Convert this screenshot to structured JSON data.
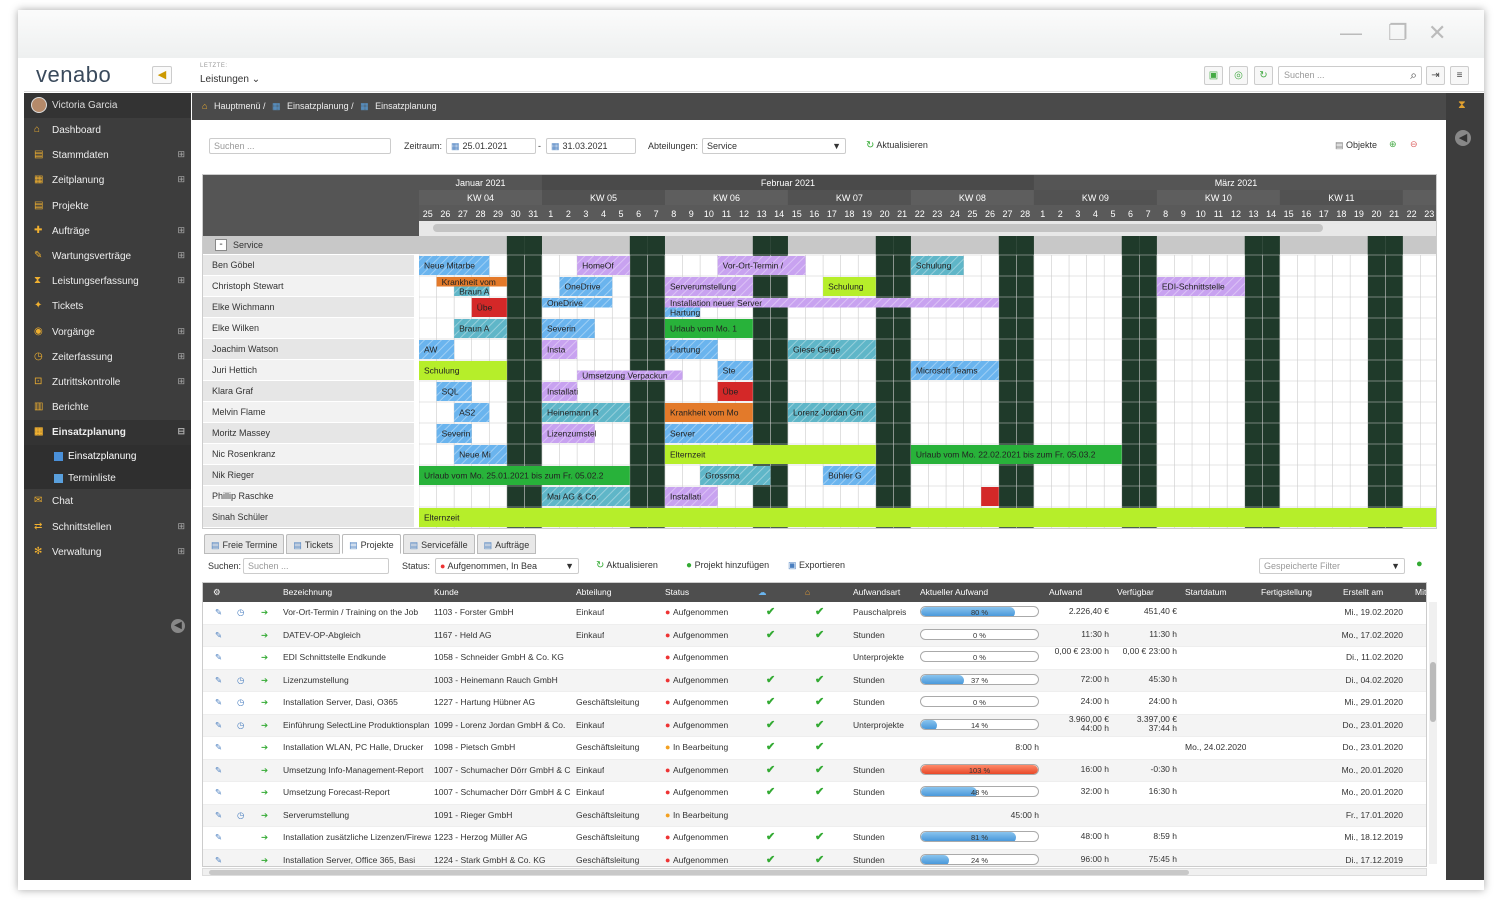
{
  "window": {
    "min": "—",
    "max": "❐",
    "close": "✕"
  },
  "app": {
    "logo": "venabo",
    "letzte": "LETZTE:",
    "recent": "Leistungen ⌄",
    "search_placeholder": "Suchen ..."
  },
  "user": {
    "name": "Victoria Garcia"
  },
  "sidebar": [
    {
      "label": "Dashboard",
      "icon": "home-icon",
      "plus": ""
    },
    {
      "label": "Stammdaten",
      "icon": "folder-icon",
      "plus": "⊞"
    },
    {
      "label": "Zeitplanung",
      "icon": "calendar-icon",
      "plus": "⊞"
    },
    {
      "label": "Projekte",
      "icon": "folder-icon",
      "plus": ""
    },
    {
      "label": "Aufträge",
      "icon": "order-icon",
      "plus": "⊞"
    },
    {
      "label": "Wartungsverträge",
      "icon": "wrench-icon",
      "plus": "⊞"
    },
    {
      "label": "Leistungserfassung",
      "icon": "hourglass-icon",
      "plus": "⊞"
    },
    {
      "label": "Tickets",
      "icon": "ticket-icon",
      "plus": ""
    },
    {
      "label": "Vorgänge",
      "icon": "process-icon",
      "plus": "⊞"
    },
    {
      "label": "Zeiterfassung",
      "icon": "clock-icon",
      "plus": "⊞"
    },
    {
      "label": "Zutrittskontrolle",
      "icon": "door-icon",
      "plus": "⊞"
    },
    {
      "label": "Berichte",
      "icon": "report-icon",
      "plus": ""
    },
    {
      "label": "Einsatzplanung",
      "icon": "plan-icon",
      "plus": "⊟"
    }
  ],
  "sidebar_sub": [
    "Einsatzplanung",
    "Terminliste"
  ],
  "sidebar_bottom": [
    {
      "label": "Chat",
      "icon": "chat-icon",
      "plus": ""
    },
    {
      "label": "Schnittstellen",
      "icon": "plug-icon",
      "plus": "⊞"
    },
    {
      "label": "Verwaltung",
      "icon": "gear-icon",
      "plus": "⊞"
    }
  ],
  "breadcrumb": [
    "Hauptmenü /",
    "Einsatzplanung /",
    "Einsatzplanung"
  ],
  "filters": {
    "search_placeholder": "Suchen ...",
    "zeitraum_label": "Zeitraum:",
    "date_from": "25.01.2021",
    "date_sep": "-",
    "date_to": "31.03.2021",
    "abteilungen_label": "Abteilungen:",
    "abteilung": "Service",
    "refresh": "Aktualisieren",
    "objekte": "Objekte"
  },
  "gantt": {
    "months": [
      {
        "label": "Januar 2021",
        "days": 7
      },
      {
        "label": "Februar 2021",
        "days": 28
      },
      {
        "label": "März 2021",
        "days": 23
      }
    ],
    "weeks": [
      {
        "label": "KW 04",
        "days": 7
      },
      {
        "label": "KW 05",
        "days": 7
      },
      {
        "label": "KW 06",
        "days": 7
      },
      {
        "label": "KW 07",
        "days": 7
      },
      {
        "label": "KW 08",
        "days": 7
      },
      {
        "label": "KW 09",
        "days": 7
      },
      {
        "label": "KW 10",
        "days": 7
      },
      {
        "label": "KW 11",
        "days": 7
      },
      {
        "label": "",
        "days": 2
      }
    ],
    "days": [
      "25",
      "26",
      "27",
      "28",
      "29",
      "30",
      "31",
      "1",
      "2",
      "3",
      "4",
      "5",
      "6",
      "7",
      "8",
      "9",
      "10",
      "11",
      "12",
      "13",
      "14",
      "15",
      "16",
      "17",
      "18",
      "19",
      "20",
      "21",
      "22",
      "23",
      "24",
      "25",
      "26",
      "27",
      "28",
      "1",
      "2",
      "3",
      "4",
      "5",
      "6",
      "7",
      "8",
      "9",
      "10",
      "11",
      "12",
      "13",
      "14",
      "15",
      "16",
      "17",
      "18",
      "19",
      "20",
      "21",
      "22",
      "23"
    ],
    "group": "Service",
    "employees": [
      "Ben Göbel",
      "Christoph Stewart",
      "Elke Wichmann",
      "Elke Wilken",
      "Joachim Watson",
      "Juri Hettich",
      "Klara Graf",
      "Melvin Flame",
      "Moritz Massey",
      "Nic Rosenkranz",
      "Nik Rieger",
      "Phillip Raschke",
      "Sinah Schüler"
    ],
    "colors": {
      "blue": "#6ab4ee",
      "purple": "#c8a2f0",
      "green": "#28b23a",
      "lime": "#b6ee2a",
      "orange": "#e37a2a",
      "red": "#d42828",
      "teal": "#5fb6c8",
      "weekend": "#1f3a2a"
    },
    "events": [
      {
        "row": 0,
        "start": 0,
        "len": 4,
        "color": "blue",
        "label": "Neue Mitarbe"
      },
      {
        "row": 0,
        "start": 9,
        "len": 3,
        "color": "purple",
        "label": "HomeOf"
      },
      {
        "row": 0,
        "start": 17,
        "len": 5,
        "color": "purple",
        "label": "Vor-Ort-Termin /"
      },
      {
        "row": 0,
        "start": 28,
        "len": 3,
        "color": "teal",
        "label": "Schulung"
      },
      {
        "row": 1,
        "start": 1,
        "len": 4,
        "color": "orange",
        "label": "Krankheit vom",
        "half": "top"
      },
      {
        "row": 1,
        "start": 2,
        "len": 2,
        "color": "teal",
        "label": "Braun A",
        "half": "bottom"
      },
      {
        "row": 1,
        "start": 8,
        "len": 3,
        "color": "blue",
        "label": "OneDrive"
      },
      {
        "row": 1,
        "start": 14,
        "len": 5,
        "color": "purple",
        "label": "Serverumstellung"
      },
      {
        "row": 1,
        "start": 23,
        "len": 3,
        "color": "lime",
        "label": "Schulung"
      },
      {
        "row": 1,
        "start": 42,
        "len": 5,
        "color": "purple",
        "label": "EDI-Schnittstelle"
      },
      {
        "row": 2,
        "start": 3,
        "len": 2,
        "color": "red",
        "label": "Übe"
      },
      {
        "row": 2,
        "start": 7,
        "len": 4,
        "color": "blue",
        "label": "OneDrive",
        "half": "top"
      },
      {
        "row": 2,
        "start": 14,
        "len": 19,
        "color": "purple",
        "label": "Installation neuer Server",
        "half": "top"
      },
      {
        "row": 2,
        "start": 14,
        "len": 2,
        "color": "blue",
        "label": "Hartung",
        "half": "bottom"
      },
      {
        "row": 3,
        "start": 2,
        "len": 3,
        "color": "teal",
        "label": "Braun A"
      },
      {
        "row": 3,
        "start": 7,
        "len": 3,
        "color": "blue",
        "label": "Severin"
      },
      {
        "row": 3,
        "start": 14,
        "len": 5,
        "color": "green",
        "label": "Urlaub vom Mo. 1"
      },
      {
        "row": 4,
        "start": 0,
        "len": 2,
        "color": "blue",
        "label": "AW"
      },
      {
        "row": 4,
        "start": 7,
        "len": 2,
        "color": "purple",
        "label": "Insta"
      },
      {
        "row": 4,
        "start": 14,
        "len": 3,
        "color": "blue",
        "label": "Hartung"
      },
      {
        "row": 4,
        "start": 21,
        "len": 5,
        "color": "teal",
        "label": "Giese Geige"
      },
      {
        "row": 5,
        "start": 0,
        "len": 5,
        "color": "lime",
        "label": "Schulung"
      },
      {
        "row": 5,
        "start": 9,
        "len": 6,
        "color": "purple",
        "label": "Umsetzung Verpackun",
        "half": "bottom"
      },
      {
        "row": 5,
        "start": 17,
        "len": 2,
        "color": "blue",
        "label": "Ste"
      },
      {
        "row": 5,
        "start": 28,
        "len": 5,
        "color": "blue",
        "label": "Microsoft Teams"
      },
      {
        "row": 6,
        "start": 1,
        "len": 2,
        "color": "blue",
        "label": "SQL"
      },
      {
        "row": 6,
        "start": 7,
        "len": 2,
        "color": "purple",
        "label": "Installati"
      },
      {
        "row": 6,
        "start": 17,
        "len": 2,
        "color": "red",
        "label": "Übe"
      },
      {
        "row": 7,
        "start": 2,
        "len": 2,
        "color": "blue",
        "label": "AS2"
      },
      {
        "row": 7,
        "start": 7,
        "len": 5,
        "color": "teal",
        "label": "Heinemann R"
      },
      {
        "row": 7,
        "start": 14,
        "len": 5,
        "color": "orange",
        "label": "Krankheit vom Mo"
      },
      {
        "row": 7,
        "start": 21,
        "len": 5,
        "color": "teal",
        "label": "Lorenz Jordan Gm"
      },
      {
        "row": 8,
        "start": 1,
        "len": 2,
        "color": "blue",
        "label": "Severin"
      },
      {
        "row": 8,
        "start": 7,
        "len": 3,
        "color": "purple",
        "label": "Lizenzumstel"
      },
      {
        "row": 8,
        "start": 14,
        "len": 5,
        "color": "blue",
        "label": "Server"
      },
      {
        "row": 9,
        "start": 2,
        "len": 3,
        "color": "blue",
        "label": "Neue Mi"
      },
      {
        "row": 9,
        "start": 14,
        "len": 12,
        "color": "lime",
        "label": "Elternzeit"
      },
      {
        "row": 9,
        "start": 28,
        "len": 12,
        "color": "green",
        "label": "Urlaub vom Mo. 22.02.2021 bis zum Fr. 05.03.2"
      },
      {
        "row": 10,
        "start": 0,
        "len": 12,
        "color": "green",
        "label": "Urlaub vom Mo. 25.01.2021 bis zum Fr. 05.02.2"
      },
      {
        "row": 10,
        "start": 16,
        "len": 4,
        "color": "teal",
        "label": "Grossma"
      },
      {
        "row": 10,
        "start": 23,
        "len": 3,
        "color": "blue",
        "label": "Bühler G"
      },
      {
        "row": 11,
        "start": 7,
        "len": 5,
        "color": "teal",
        "label": "Mai AG & Co."
      },
      {
        "row": 11,
        "start": 14,
        "len": 3,
        "color": "purple",
        "label": "Installati"
      },
      {
        "row": 11,
        "start": 32,
        "len": 1,
        "color": "red",
        "label": ""
      },
      {
        "row": 12,
        "start": 0,
        "len": 58,
        "color": "lime",
        "label": "Elternzeit"
      }
    ]
  },
  "tabs": [
    "Freie Termine",
    "Tickets",
    "Projekte",
    "Servicefälle",
    "Aufträge"
  ],
  "proj": {
    "search_label": "Suchen:",
    "search_placeholder": "Suchen ...",
    "status_label": "Status:",
    "status_value": "Aufgenommen, In Bea",
    "refresh": "Aktualisieren",
    "add": "Projekt hinzufügen",
    "export": "Exportieren",
    "filter_placeholder": "Gespeicherte Filter",
    "columns": [
      "Bezeichnung",
      "Kunde",
      "Abteilung",
      "Status",
      "",
      "",
      "Aufwandsart",
      "Aktueller Aufwand",
      "Aufwand",
      "Verfügbar",
      "Startdatum",
      "Fertigstellung",
      "Erstellt am",
      "Mitar"
    ],
    "rows": [
      {
        "t": "Vor-Ort-Termin / Training on the Job",
        "k": "1103 - Forster GmbH",
        "a": "Einkauf",
        "s": "Aufgenommen",
        "c1": "✔",
        "c2": "✔",
        "art": "Pauschalpreis",
        "p": 80,
        "pt": "80 %",
        "red": false,
        "aw": "2.226,40 €",
        "vf": "451,40 €",
        "sd": "",
        "e": "Mi., 19.02.2020",
        "clock": true
      },
      {
        "t": "DATEV-OP-Abgleich",
        "k": "1167 - Held AG",
        "a": "Einkauf",
        "s": "Aufgenommen",
        "c1": "✔",
        "c2": "✔",
        "art": "Stunden",
        "p": 0,
        "pt": "0 %",
        "red": false,
        "aw": "11:30 h",
        "vf": "11:30 h",
        "sd": "",
        "e": "Mo., 17.02.2020",
        "clock": false
      },
      {
        "t": "EDI Schnittstelle Endkunde",
        "k": "1058 - Schneider GmbH & Co. KG",
        "a": "",
        "s": "Aufgenommen",
        "c1": "",
        "c2": "",
        "art": "Unterprojekte",
        "p": 0,
        "pt": "0 %",
        "red": false,
        "aw": "0,00 € 23:00 h",
        "vf": "0,00 € 23:00 h",
        "sd": "",
        "e": "Di., 11.02.2020",
        "clock": false
      },
      {
        "t": "Lizenzumstellung",
        "k": "1003 - Heinemann Rauch GmbH",
        "a": "",
        "s": "Aufgenommen",
        "c1": "✔",
        "c2": "✔",
        "art": "Stunden",
        "p": 37,
        "pt": "37 %",
        "red": false,
        "aw": "72:00 h",
        "vf": "45:30 h",
        "sd": "",
        "e": "Di., 04.02.2020",
        "clock": true
      },
      {
        "t": "Installation Server, Dasi, O365",
        "k": "1227 - Hartung Hübner AG",
        "a": "Geschäftsleitung",
        "s": "Aufgenommen",
        "c1": "✔",
        "c2": "✔",
        "art": "Stunden",
        "p": 0,
        "pt": "0 %",
        "red": false,
        "aw": "24:00 h",
        "vf": "24:00 h",
        "sd": "",
        "e": "Mi., 29.01.2020",
        "clock": true
      },
      {
        "t": "Einführung SelectLine Produktionsplan",
        "k": "1099 - Lorenz Jordan GmbH & Co.",
        "a": "Einkauf",
        "s": "Aufgenommen",
        "c1": "✔",
        "c2": "✔",
        "art": "Unterprojekte",
        "p": 14,
        "pt": "14 %",
        "red": false,
        "aw": "3.960,00 € 44:00 h",
        "vf": "3.397,00 € 37:44 h",
        "sd": "",
        "e": "Do., 23.01.2020",
        "clock": true
      },
      {
        "t": "Installation WLAN, PC Halle, Drucker",
        "k": "1098 - Pietsch GmbH",
        "a": "Geschäftsleitung",
        "s": "In Bearbeitung",
        "c1": "✔",
        "c2": "✔",
        "art": "",
        "p": -1,
        "pt": "8:00 h",
        "red": false,
        "aw": "",
        "vf": "",
        "sd": "Mo., 24.02.2020",
        "e": "Do., 23.01.2020",
        "clock": false
      },
      {
        "t": "Umsetzung Info-Management-Report",
        "k": "1007 - Schumacher Dörr GmbH & C",
        "a": "Einkauf",
        "s": "Aufgenommen",
        "c1": "✔",
        "c2": "✔",
        "art": "Stunden",
        "p": 100,
        "pt": "103 %",
        "red": true,
        "aw": "16:00 h",
        "vf": "-0:30 h",
        "sd": "",
        "e": "Mo., 20.01.2020",
        "clock": false
      },
      {
        "t": "Umsetzung Forecast-Report",
        "k": "1007 - Schumacher Dörr GmbH & C",
        "a": "Einkauf",
        "s": "Aufgenommen",
        "c1": "✔",
        "c2": "✔",
        "art": "Stunden",
        "p": 48,
        "pt": "48 %",
        "red": false,
        "aw": "32:00 h",
        "vf": "16:30 h",
        "sd": "",
        "e": "Mo., 20.01.2020",
        "clock": false
      },
      {
        "t": "Serverumstellung",
        "k": "1091 - Rieger GmbH",
        "a": "Geschäftsleitung",
        "s": "In Bearbeitung",
        "c1": "",
        "c2": "",
        "art": "",
        "p": -1,
        "pt": "45:00 h",
        "red": false,
        "aw": "",
        "vf": "",
        "sd": "",
        "e": "Fr., 17.01.2020",
        "clock": true
      },
      {
        "t": "Installation zusätzliche Lizenzen/Firewall",
        "k": "1223 - Herzog Müller AG",
        "a": "Geschäftsleitung",
        "s": "Aufgenommen",
        "c1": "✔",
        "c2": "✔",
        "art": "Stunden",
        "p": 81,
        "pt": "81 %",
        "red": false,
        "aw": "48:00 h",
        "vf": "8:59 h",
        "sd": "",
        "e": "Mi., 18.12.2019",
        "clock": false
      },
      {
        "t": "Installation Server, Office 365, Basi",
        "k": "1224 - Stark GmbH & Co. KG",
        "a": "Geschäftsleitung",
        "s": "Aufgenommen",
        "c1": "✔",
        "c2": "✔",
        "art": "Stunden",
        "p": 24,
        "pt": "24 %",
        "red": false,
        "aw": "96:00 h",
        "vf": "75:45 h",
        "sd": "",
        "e": "Di., 17.12.2019",
        "clock": false
      }
    ]
  }
}
